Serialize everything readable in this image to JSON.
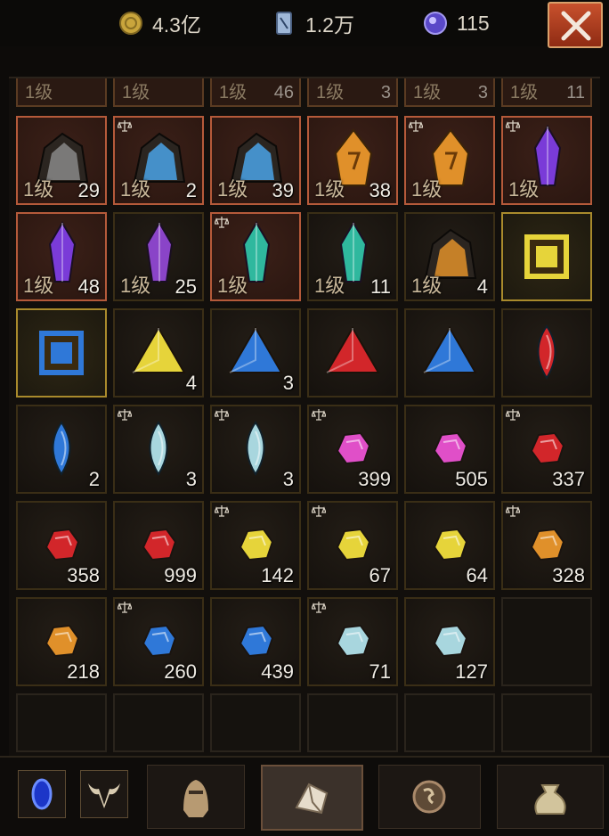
{
  "currencies": [
    {
      "icon": "gold-coin-icon",
      "value": "4.3亿"
    },
    {
      "icon": "blue-shard-icon",
      "value": "1.2万"
    },
    {
      "icon": "purple-orb-icon",
      "value": "115"
    }
  ],
  "partial_row": [
    {
      "level": "1级",
      "count": ""
    },
    {
      "level": "1级",
      "count": ""
    },
    {
      "level": "1级",
      "count": "46"
    },
    {
      "level": "1级",
      "count": "3"
    },
    {
      "level": "1级",
      "count": "3"
    },
    {
      "level": "1级",
      "count": "11"
    }
  ],
  "rows": [
    [
      {
        "name": "dark-purple-ore",
        "level": "1级",
        "count": "29",
        "style": "rare",
        "bound": false
      },
      {
        "name": "blue-crystal-ore",
        "level": "1级",
        "count": "2",
        "style": "rare",
        "bound": true
      },
      {
        "name": "blue-crystal-ore",
        "level": "1级",
        "count": "39",
        "style": "rare",
        "bound": false
      },
      {
        "name": "amber-rune-stone",
        "level": "1级",
        "count": "38",
        "style": "rare",
        "bound": false
      },
      {
        "name": "amber-rune-stone",
        "level": "1级",
        "count": "",
        "style": "rare",
        "bound": true
      },
      {
        "name": "purple-crystal",
        "level": "1级",
        "count": "",
        "style": "rare",
        "bound": true
      }
    ],
    [
      {
        "name": "purple-crystal",
        "level": "1级",
        "count": "48",
        "style": "rare",
        "bound": false
      },
      {
        "name": "violet-shard",
        "level": "1级",
        "count": "25",
        "style": "",
        "bound": false
      },
      {
        "name": "teal-crystal",
        "level": "1级",
        "count": "",
        "style": "rare",
        "bound": true
      },
      {
        "name": "teal-crystal",
        "level": "1级",
        "count": "11",
        "style": "",
        "bound": false
      },
      {
        "name": "amber-ore",
        "level": "1级",
        "count": "4",
        "style": "",
        "bound": false
      },
      {
        "name": "topaz-square",
        "level": "",
        "count": "",
        "style": "gold",
        "bound": false
      }
    ],
    [
      {
        "name": "sapphire-square",
        "level": "",
        "count": "",
        "style": "gold",
        "bound": false
      },
      {
        "name": "topaz-triangle",
        "level": "",
        "count": "4",
        "style": "",
        "bound": false
      },
      {
        "name": "sapphire-triangle",
        "level": "",
        "count": "3",
        "style": "",
        "bound": false
      },
      {
        "name": "ruby-triangle",
        "level": "",
        "count": "",
        "style": "",
        "bound": false
      },
      {
        "name": "sapphire-triangle",
        "level": "",
        "count": "",
        "style": "",
        "bound": false
      },
      {
        "name": "ruby-marquise",
        "level": "",
        "count": "",
        "style": "",
        "bound": false
      }
    ],
    [
      {
        "name": "sapphire-marquise",
        "level": "",
        "count": "2",
        "style": "",
        "bound": false
      },
      {
        "name": "diamond-marquise",
        "level": "",
        "count": "3",
        "style": "",
        "bound": true
      },
      {
        "name": "diamond-marquise",
        "level": "",
        "count": "3",
        "style": "",
        "bound": true
      },
      {
        "name": "amethyst-chipped",
        "level": "",
        "count": "399",
        "style": "",
        "bound": true
      },
      {
        "name": "amethyst-chipped",
        "level": "",
        "count": "505",
        "style": "",
        "bound": false
      },
      {
        "name": "ruby-chipped",
        "level": "",
        "count": "337",
        "style": "",
        "bound": true
      }
    ],
    [
      {
        "name": "ruby-chipped",
        "level": "",
        "count": "358",
        "style": "",
        "bound": false
      },
      {
        "name": "ruby-chipped",
        "level": "",
        "count": "999",
        "style": "",
        "bound": false
      },
      {
        "name": "topaz-chipped",
        "level": "",
        "count": "142",
        "style": "",
        "bound": true
      },
      {
        "name": "topaz-chipped",
        "level": "",
        "count": "67",
        "style": "",
        "bound": true
      },
      {
        "name": "topaz-chipped",
        "level": "",
        "count": "64",
        "style": "",
        "bound": false
      },
      {
        "name": "amber-chipped",
        "level": "",
        "count": "328",
        "style": "",
        "bound": true
      }
    ],
    [
      {
        "name": "amber-chipped",
        "level": "",
        "count": "218",
        "style": "",
        "bound": false
      },
      {
        "name": "sapphire-chipped",
        "level": "",
        "count": "260",
        "style": "",
        "bound": true
      },
      {
        "name": "sapphire-chipped",
        "level": "",
        "count": "439",
        "style": "",
        "bound": false
      },
      {
        "name": "diamond-chipped",
        "level": "",
        "count": "71",
        "style": "",
        "bound": true
      },
      {
        "name": "diamond-chipped",
        "level": "",
        "count": "127",
        "style": "",
        "bound": false
      },
      {
        "name": "empty",
        "level": "",
        "count": "",
        "style": "empty",
        "bound": false
      }
    ]
  ],
  "tabs": [
    {
      "icon": "blue-portal-icon",
      "active": false
    },
    {
      "icon": "bull-skull-icon",
      "active": false
    },
    {
      "icon": "helmet-icon",
      "active": false
    },
    {
      "icon": "gem-pouch-icon",
      "active": true
    },
    {
      "icon": "rune-stone-icon",
      "active": false
    },
    {
      "icon": "loot-bag-icon",
      "active": false
    }
  ],
  "gem_colors": {
    "purple": "#7a3bd8",
    "blue": "#4aa3e8",
    "amber": "#e0902a",
    "teal": "#2fb89e",
    "ruby": "#d2262a",
    "sapphire": "#2f78d8",
    "diamond": "#a8d6de",
    "amethyst": "#e04fc8",
    "topaz": "#e6d43a",
    "violet": "#8a44c8"
  }
}
